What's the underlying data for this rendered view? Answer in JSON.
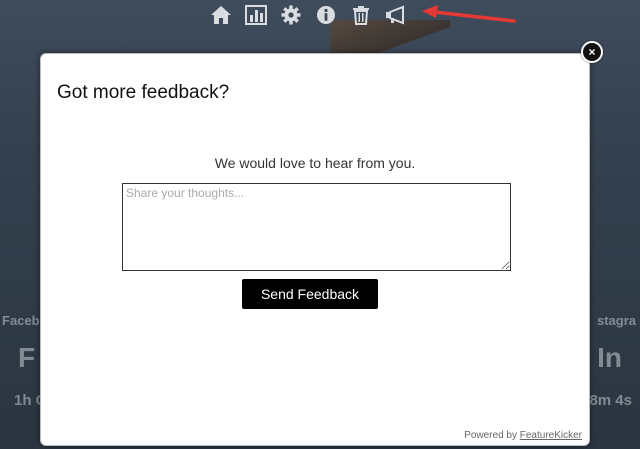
{
  "background": {
    "left_label": "Faceb",
    "right_label": "stagra",
    "left_big": "F",
    "right_big": "In",
    "left_small": "1h C",
    "right_small": "8m 4s"
  },
  "toolbar": {
    "icons": [
      "home-icon",
      "bar-chart-icon",
      "gear-icon",
      "info-icon",
      "trash-icon",
      "megaphone-icon"
    ],
    "color": "#d9dde2"
  },
  "annotation": {
    "arrow_color": "#e53935"
  },
  "modal": {
    "title": "Got more feedback?",
    "subtitle": "We would love to hear from you.",
    "textarea_placeholder": "Share your thoughts...",
    "textarea_value": "",
    "send_button_label": "Send Feedback",
    "powered_by_prefix": "Powered by ",
    "powered_by_link": "FeatureKicker",
    "close_symbol": "×"
  }
}
